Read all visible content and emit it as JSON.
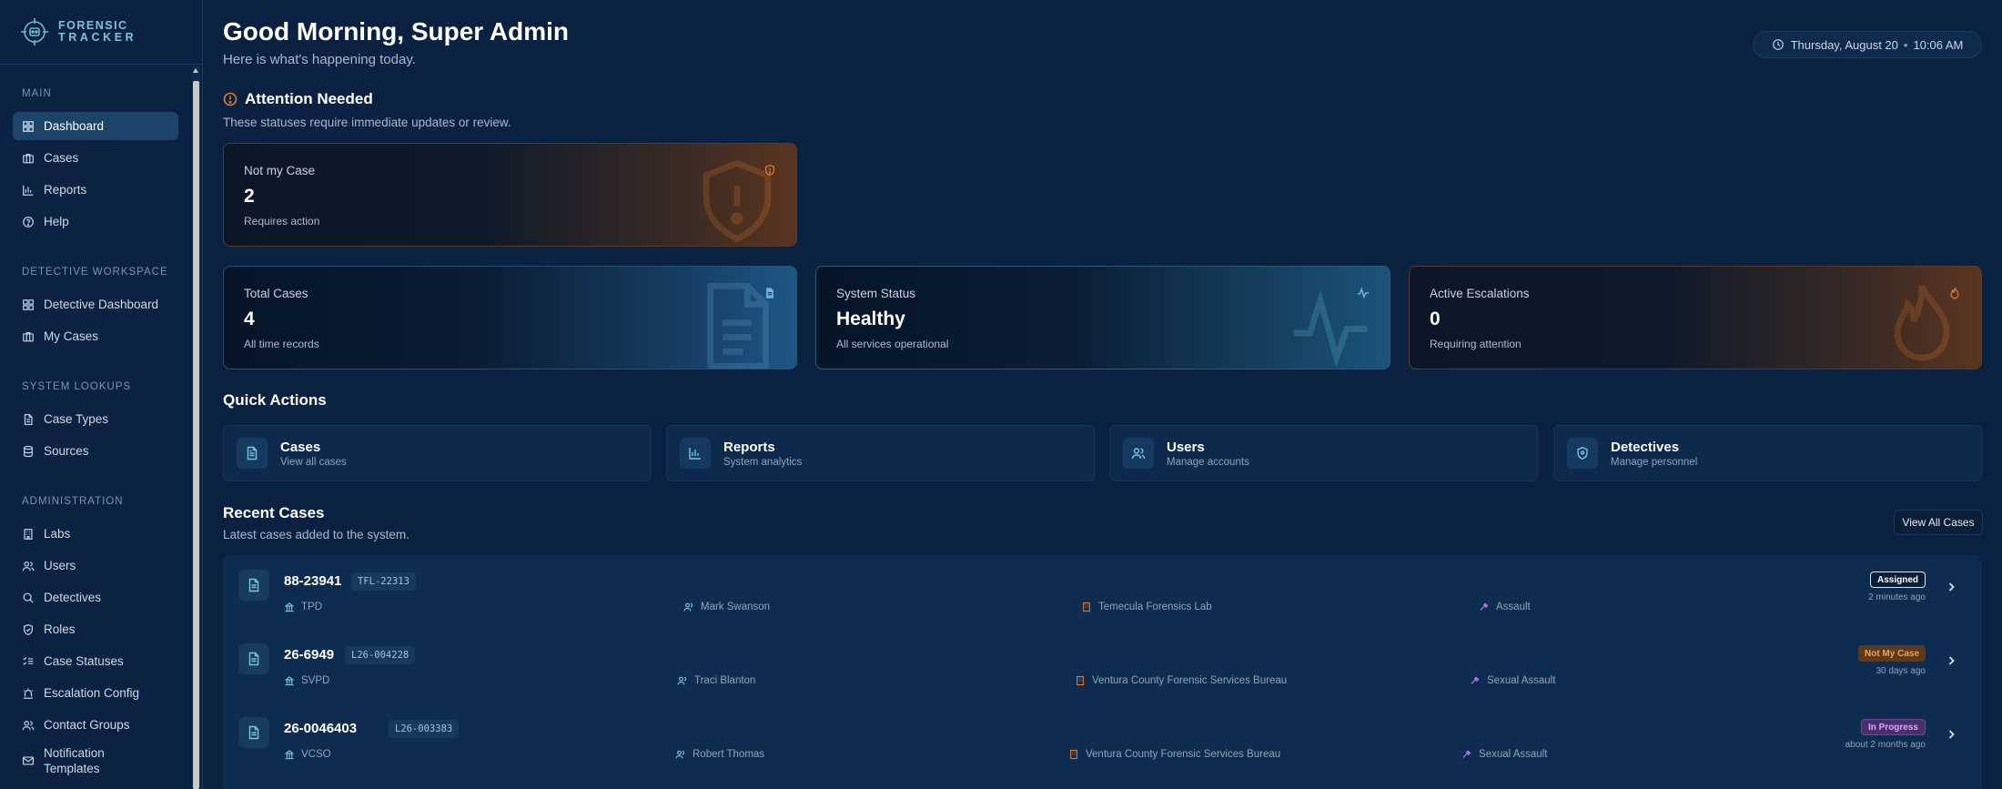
{
  "brand": {
    "line1": "FORENSIC",
    "line2": "TRACKER"
  },
  "sidebar": {
    "sections": [
      {
        "label": "MAIN",
        "items": [
          {
            "label": "Dashboard",
            "icon": "grid-icon",
            "active": true
          },
          {
            "label": "Cases",
            "icon": "briefcase-icon"
          },
          {
            "label": "Reports",
            "icon": "bar-chart-icon"
          },
          {
            "label": "Help",
            "icon": "help-circle-icon"
          }
        ]
      },
      {
        "label": "DETECTIVE WORKSPACE",
        "items": [
          {
            "label": "Detective Dashboard",
            "icon": "grid-icon"
          },
          {
            "label": "My Cases",
            "icon": "briefcase-icon"
          }
        ]
      },
      {
        "label": "SYSTEM LOOKUPS",
        "items": [
          {
            "label": "Case Types",
            "icon": "file-icon"
          },
          {
            "label": "Sources",
            "icon": "database-icon"
          }
        ]
      },
      {
        "label": "ADMINISTRATION",
        "items": [
          {
            "label": "Labs",
            "icon": "building-icon"
          },
          {
            "label": "Users",
            "icon": "users-icon"
          },
          {
            "label": "Detectives",
            "icon": "search-icon"
          },
          {
            "label": "Roles",
            "icon": "shield-check-icon"
          },
          {
            "label": "Case Statuses",
            "icon": "list-checks-icon"
          },
          {
            "label": "Escalation Config",
            "icon": "siren-icon"
          },
          {
            "label": "Contact Groups",
            "icon": "contacts-icon"
          },
          {
            "label": "Notification Templates",
            "icon": "mail-icon"
          }
        ]
      }
    ]
  },
  "header": {
    "greeting": "Good Morning, Super Admin",
    "subtitle": "Here is what's happening today.",
    "date": "Thursday, August 20",
    "time": "10:06 AM"
  },
  "attention": {
    "title": "Attention Needed",
    "subtitle": "These statuses require immediate updates or review.",
    "card": {
      "label": "Not my Case",
      "value": "2",
      "note": "Requires action"
    }
  },
  "stats": [
    {
      "label": "Total Cases",
      "value": "4",
      "note": "All time records",
      "icon": "file-text-icon"
    },
    {
      "label": "System Status",
      "value": "Healthy",
      "note": "All services operational",
      "icon": "activity-icon"
    },
    {
      "label": "Active Escalations",
      "value": "0",
      "note": "Requiring attention",
      "icon": "flame-icon"
    }
  ],
  "quick_actions": {
    "title": "Quick Actions",
    "items": [
      {
        "name": "Cases",
        "desc": "View all cases",
        "icon": "file-text-icon"
      },
      {
        "name": "Reports",
        "desc": "System analytics",
        "icon": "bar-chart-icon"
      },
      {
        "name": "Users",
        "desc": "Manage accounts",
        "icon": "users-icon"
      },
      {
        "name": "Detectives",
        "desc": "Manage personnel",
        "icon": "shield-icon"
      }
    ]
  },
  "recent": {
    "title": "Recent Cases",
    "subtitle": "Latest cases added to the system.",
    "view_all": "View All Cases",
    "rows": [
      {
        "case_no": "88-23941",
        "code": "TFL-22313",
        "agency": "TPD",
        "detective": "Mark Swanson",
        "lab": "Temecula Forensics Lab",
        "type": "Assault",
        "status": "Assigned",
        "ago": "2 minutes ago"
      },
      {
        "case_no": "26-6949",
        "code": "L26-004228",
        "agency": "SVPD",
        "detective": "Traci Blanton",
        "lab": "Ventura County Forensic Services Bureau",
        "type": "Sexual Assault",
        "status": "Not My Case",
        "ago": "30 days ago"
      },
      {
        "case_no": "26-0046403",
        "code": "L26-003383",
        "agency": "VCSO",
        "detective": "Robert Thomas",
        "lab": "Ventura County Forensic Services Bureau",
        "type": "Sexual Assault",
        "status": "In Progress",
        "ago": "about 2 months ago"
      }
    ]
  },
  "colors": {
    "accent": "#7cc3dd",
    "warning": "#e07a2c",
    "active_nav": "#1c4468"
  }
}
